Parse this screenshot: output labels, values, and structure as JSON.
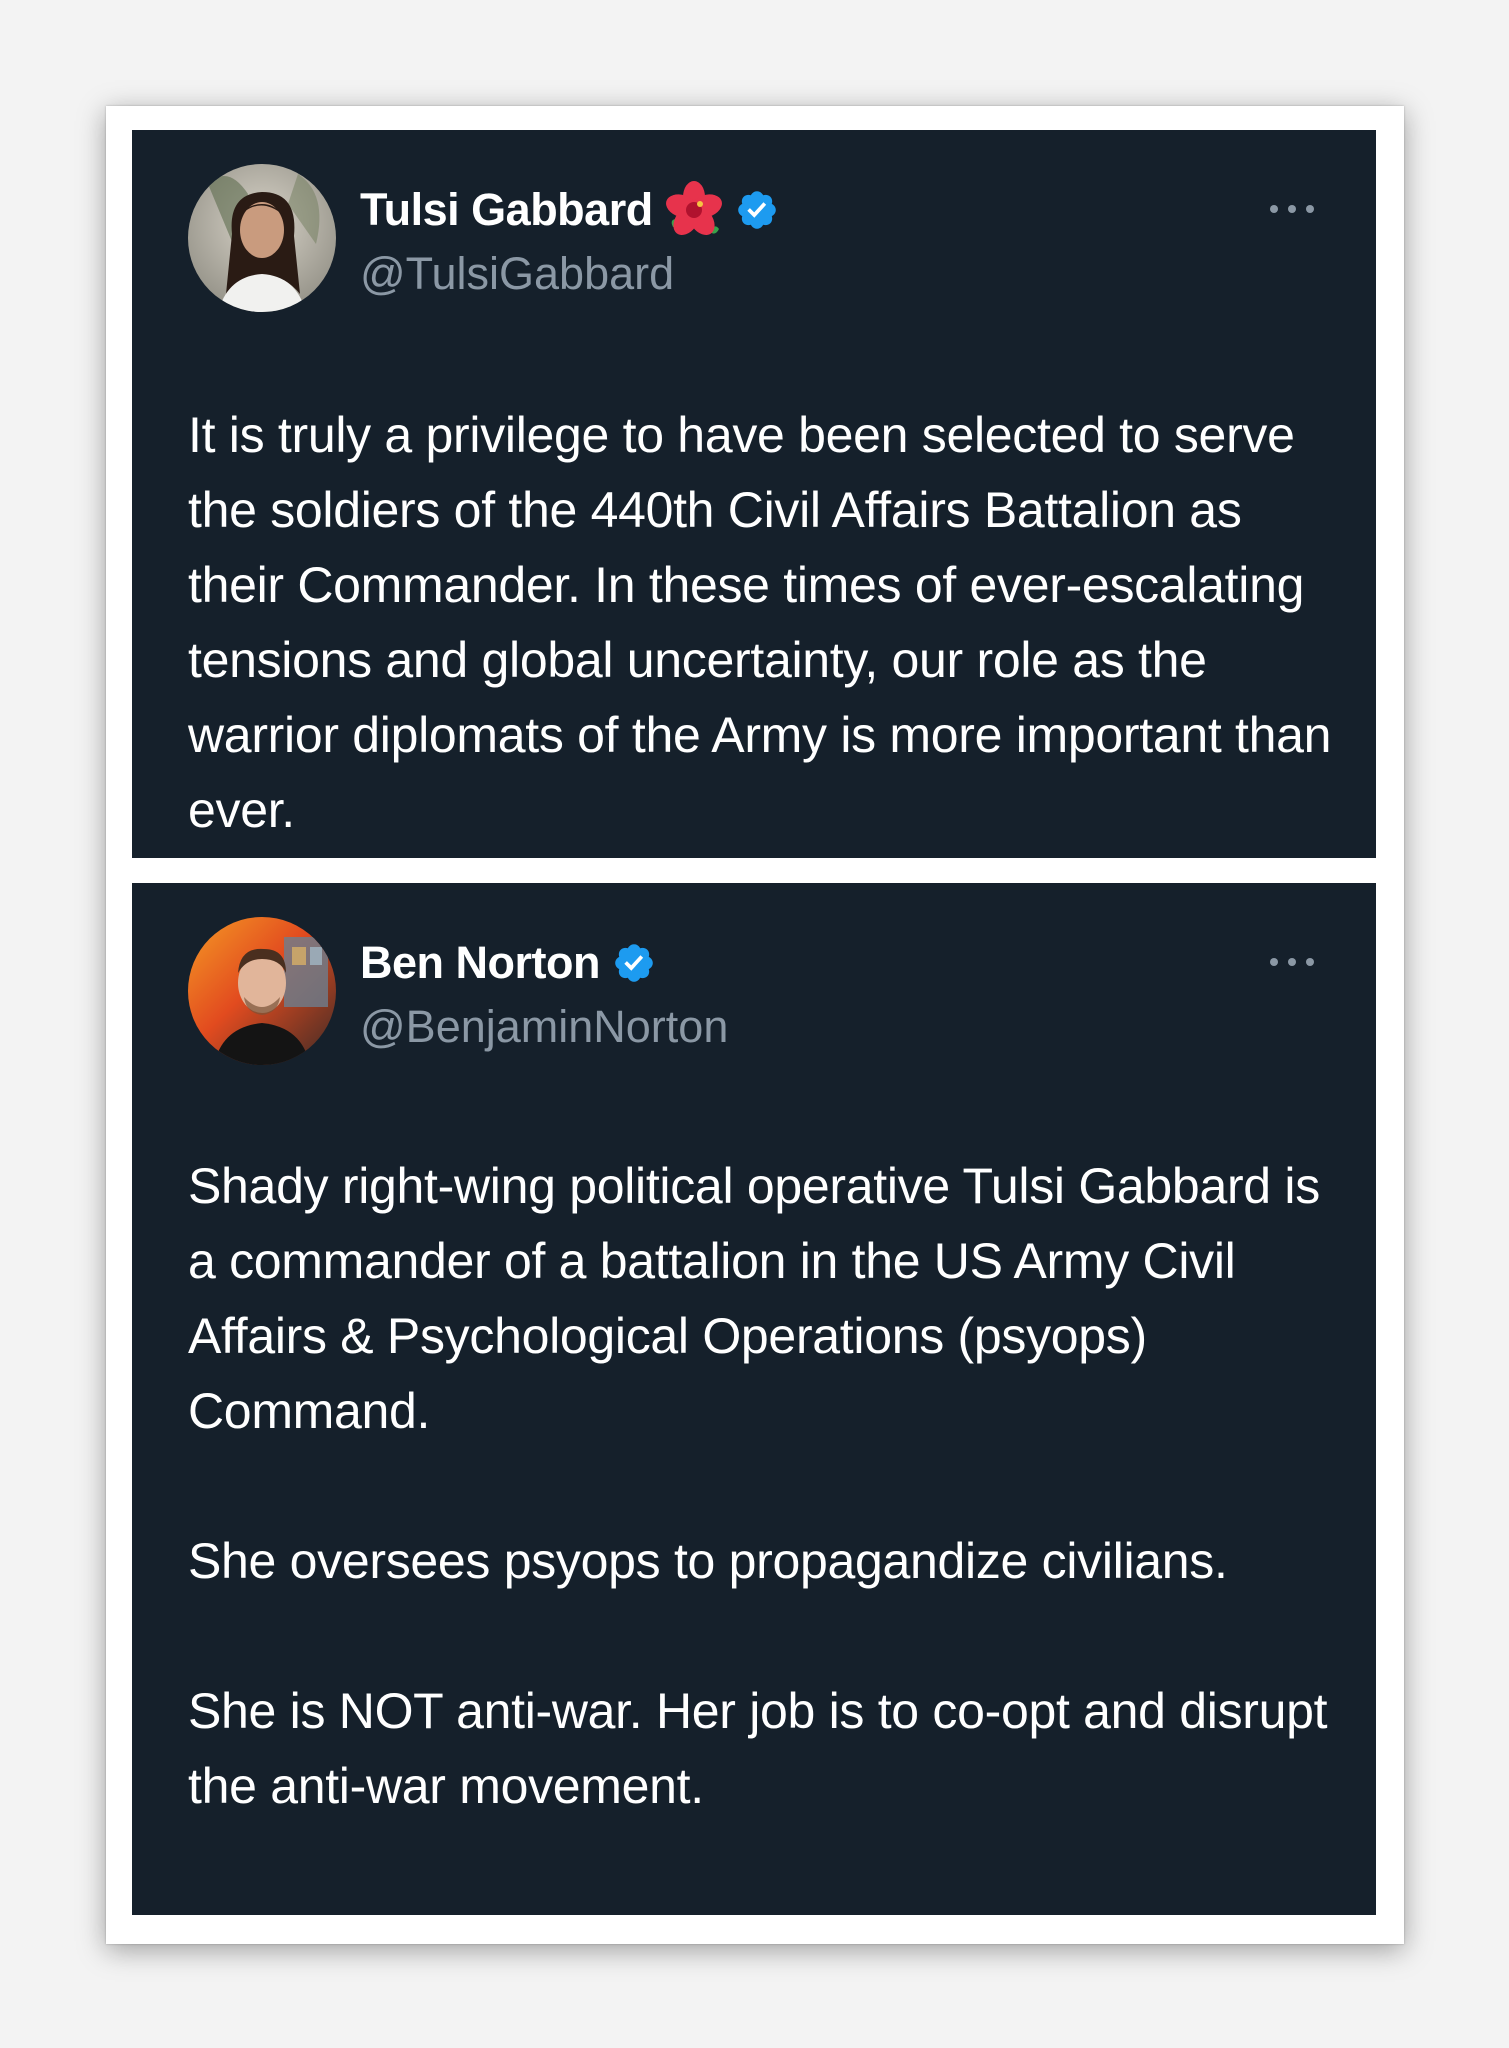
{
  "tweets": [
    {
      "author": {
        "display_name": "Tulsi Gabbard",
        "handle": "@TulsiGabbard",
        "emoji": "hibiscus-flower-icon",
        "verified": true,
        "avatar": "avatar-woman-photo"
      },
      "menu_icon": "more-options-icon",
      "paragraphs": [
        "It is truly a privilege to have been selected to serve the soldiers of the 440th Civil Affairs Battalion as their Commander. In these times of ever-escalating tensions and global uncertainty, our role as the warrior diplomats of the Army is more important than ever."
      ]
    },
    {
      "author": {
        "display_name": "Ben Norton",
        "handle": "@BenjaminNorton",
        "verified": true,
        "avatar": "avatar-man-photo"
      },
      "menu_icon": "more-options-icon",
      "paragraphs": [
        "Shady right-wing political operative Tulsi Gabbard is a commander of a battalion in the US Army Civil Affairs & Psychological Operations (psyops) Command.",
        "She oversees psyops to propagandize civilians.",
        "She is NOT anti-war. Her job is to co-opt and disrupt the anti-war movement."
      ]
    }
  ],
  "colors": {
    "card_background": "#15202b",
    "text_primary": "#ffffff",
    "text_secondary": "#8b98a5",
    "verified_badge": "#1d9bf0",
    "frame": "#ffffff",
    "page_background": "#f3f3f3"
  }
}
